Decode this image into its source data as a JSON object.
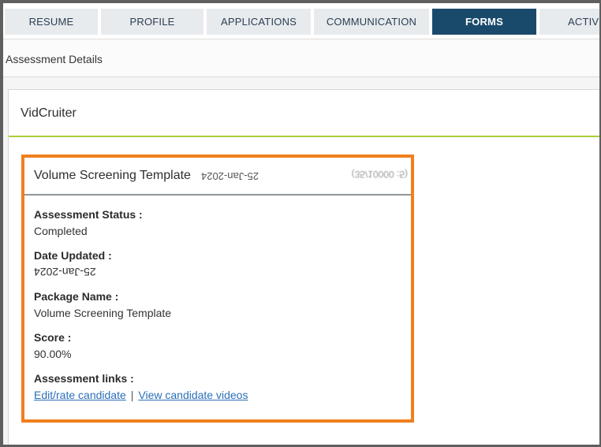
{
  "tabs": [
    {
      "label": "RESUME",
      "active": false
    },
    {
      "label": "PROFILE",
      "active": false
    },
    {
      "label": "APPLICATIONS",
      "active": false
    },
    {
      "label": "COMMUNICATION",
      "active": false
    },
    {
      "label": "FORMS",
      "active": true
    },
    {
      "label": "ACTIV",
      "active": false
    }
  ],
  "subheader": {
    "title": "Assessment Details"
  },
  "panel": {
    "title": "VidCruiter"
  },
  "card": {
    "title": "Volume Screening Template",
    "date": "25-Jan-2024",
    "note": "(35/10000 :5)",
    "fields": {
      "status_label": "Assessment Status :",
      "status_value": "Completed",
      "date_label": "Date Updated :",
      "date_value": "25-Jan-2024",
      "package_label": "Package Name :",
      "package_value": "Volume Screening Template",
      "score_label": "Score :",
      "score_value": "90.00%",
      "links_label": "Assessment links :",
      "link_edit": "Edit/rate candidate",
      "link_separator": "|",
      "link_videos": "View candidate videos"
    }
  },
  "colors": {
    "active_tab": "#1a4a6b",
    "card_border": "#f07f1d",
    "accent_line": "#a9cf3a",
    "link": "#2b6fb8"
  }
}
